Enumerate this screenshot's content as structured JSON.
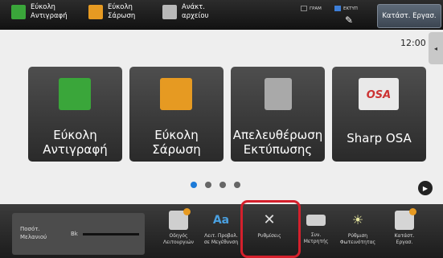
{
  "top_bar": {
    "shortcuts": [
      {
        "label_line1": "Εύκολη",
        "label_line2": "Αντιγραφή",
        "icon": "copy-icon"
      },
      {
        "label_line1": "Εύκολη",
        "label_line2": "Σάρωση",
        "icon": "scan-icon"
      },
      {
        "label_line1": "Ανάκτ.",
        "label_line2": "αρχείου",
        "icon": "file-retrieve-icon"
      }
    ],
    "indicators": {
      "fax": "ΓΡΑΜ",
      "print": "ΕΚΤΥΠ"
    },
    "job_status_button": "Κατάστ. Εργασ."
  },
  "clock": "12:00",
  "tiles": [
    {
      "line1": "Εύκολη",
      "line2": "Αντιγραφή",
      "icon": "easy-copy-icon"
    },
    {
      "line1": "Εύκολη",
      "line2": "Σάρωση",
      "icon": "easy-scan-icon"
    },
    {
      "line1": "Απελευθέρωση",
      "line2": "Εκτύπωσης",
      "icon": "print-release-icon"
    },
    {
      "line1": "Sharp OSA",
      "line2": "",
      "icon": "sharp-osa-icon",
      "logo_text": "OSA"
    }
  ],
  "pagination": {
    "pages": 4,
    "current": 1
  },
  "dock": {
    "toner": {
      "label_line1": "Ποσότ.",
      "label_line2": "Μελανιού",
      "color_label": "Bk",
      "level": 1.0
    },
    "items": [
      {
        "line1": "Οδηγός",
        "line2": "Λειτουργιών",
        "icon": "operation-guide-icon"
      },
      {
        "line1": "Λειτ. Προβολ.",
        "line2": "σε Μεγέθυνση",
        "icon": "enlarge-display-icon"
      },
      {
        "line1": "Ρυθμίσεις",
        "line2": "",
        "icon": "settings-tools-icon"
      },
      {
        "line1": "Συν.",
        "line2": "Μετρητής",
        "icon": "total-count-icon"
      },
      {
        "line1": "Ρύθμιση",
        "line2": "Φωτεινότητας",
        "icon": "brightness-icon"
      },
      {
        "line1": "Κατάστ.",
        "line2": "Εργασ.",
        "icon": "job-status-icon"
      }
    ]
  },
  "colors": {
    "highlight": "#d4202c",
    "active_dot": "#1c7ad8",
    "copy_green": "#3aa63a",
    "scan_orange": "#e69a22"
  }
}
